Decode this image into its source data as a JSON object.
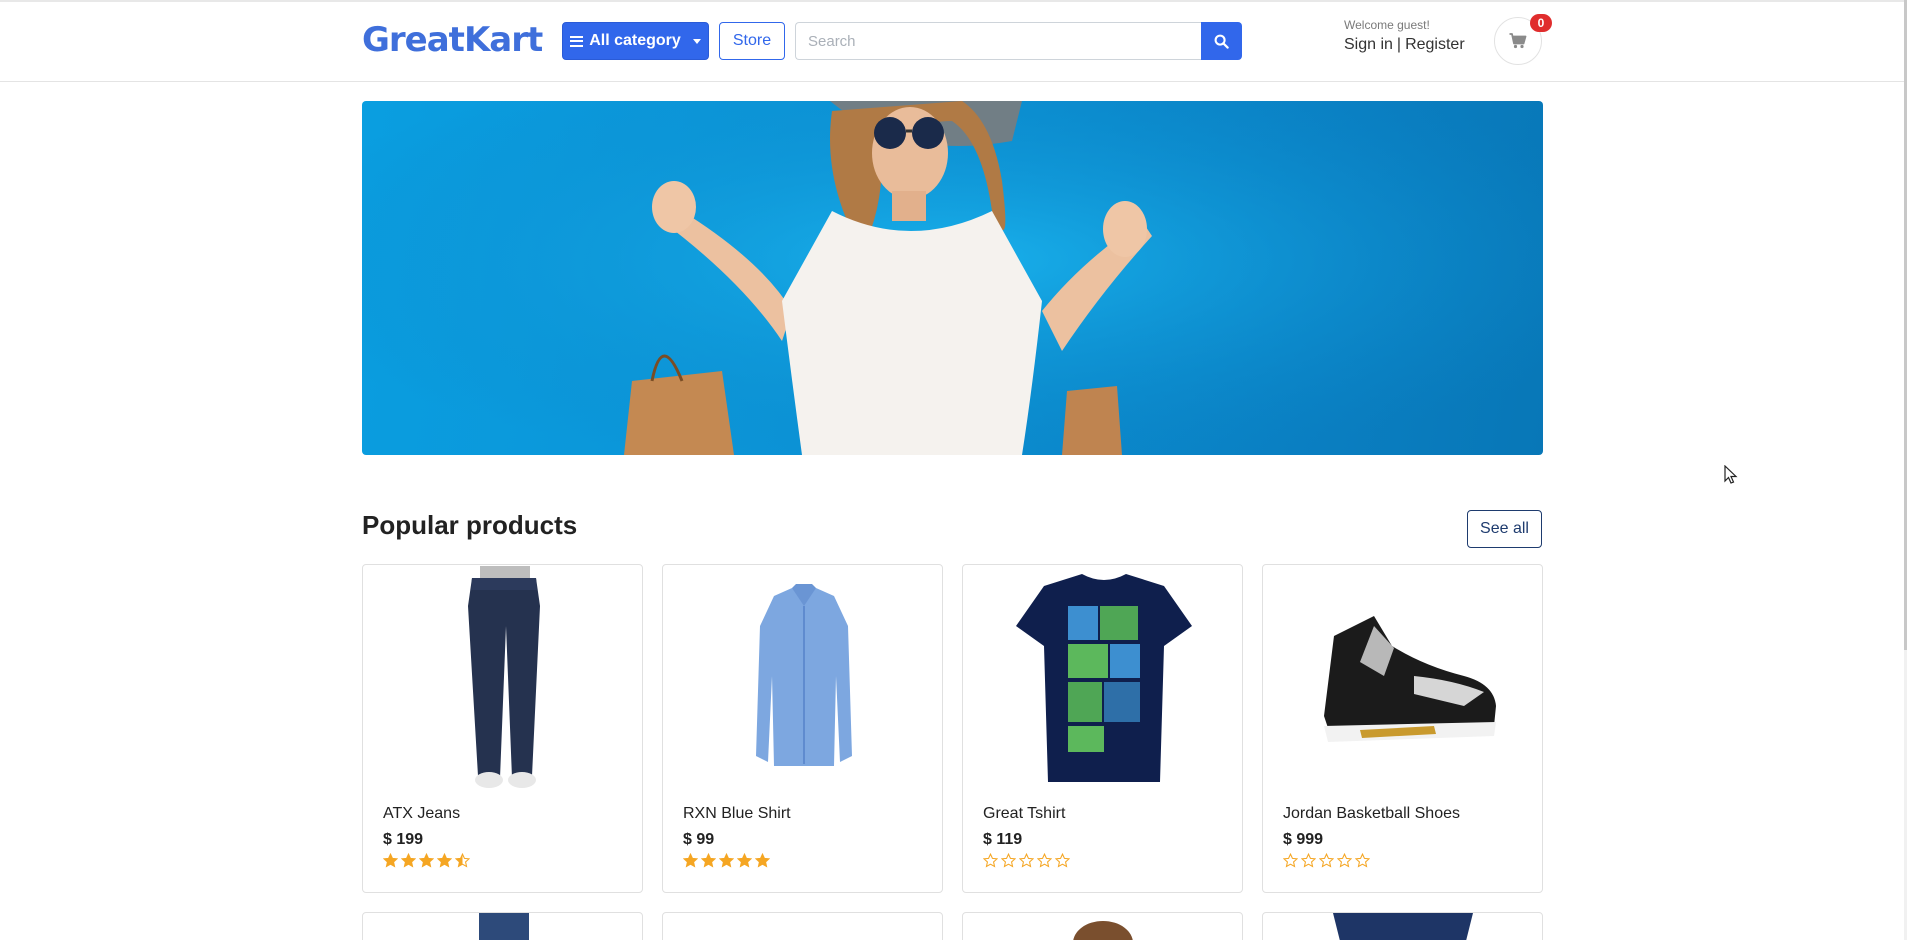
{
  "header": {
    "logo_text_1": "Great",
    "logo_text_2": "Kart",
    "category_label": "All category",
    "store_label": "Store",
    "search_placeholder": "Search",
    "welcome_text": "Welcome guest!",
    "sign_in_label": "Sign in",
    "separator": "|",
    "register_label": "Register",
    "cart_count": "0"
  },
  "icons": {
    "category": "bars-icon",
    "search": "search-icon",
    "cart": "shopping-cart-icon",
    "star": "star-icon"
  },
  "colors": {
    "primary": "#3167eb",
    "badge": "#e02d2d",
    "star": "#f5a623",
    "banner_blue": "#0a9ee0"
  },
  "section": {
    "title": "Popular products",
    "see_all_label": "See all"
  },
  "products": [
    {
      "name": "ATX Jeans",
      "price": "$ 199",
      "rating": 4.5
    },
    {
      "name": "RXN Blue Shirt",
      "price": "$ 99",
      "rating": 5
    },
    {
      "name": "Great Tshirt",
      "price": "$ 119",
      "rating": 0
    },
    {
      "name": "Jordan Basketball Shoes",
      "price": "$ 999",
      "rating": 0
    }
  ]
}
